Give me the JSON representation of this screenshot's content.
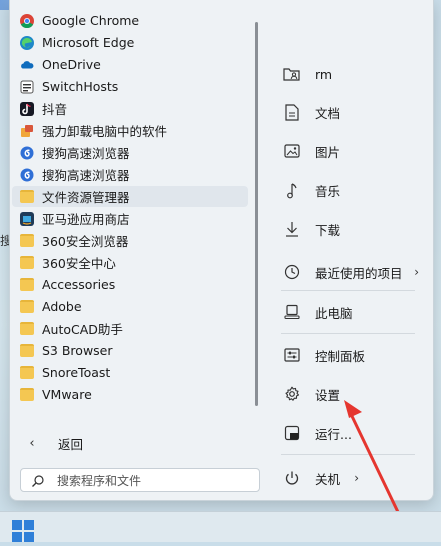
{
  "start_menu": {
    "apps": [
      {
        "label": "Google Chrome",
        "icon": "chrome-icon"
      },
      {
        "label": "Microsoft Edge",
        "icon": "edge-icon"
      },
      {
        "label": "OneDrive",
        "icon": "onedrive-icon"
      },
      {
        "label": "SwitchHosts",
        "icon": "switchhosts-icon"
      },
      {
        "label": "抖音",
        "icon": "douyin-icon"
      },
      {
        "label": "强力卸载电脑中的软件",
        "icon": "uninstall-icon"
      },
      {
        "label": "搜狗高速浏览器",
        "icon": "sogou-browser-icon"
      },
      {
        "label": "搜狗高速浏览器",
        "icon": "sogou-browser-icon"
      },
      {
        "label": "文件资源管理器",
        "icon": "folder-icon"
      },
      {
        "label": "亚马逊应用商店",
        "icon": "amazon-appstore-icon"
      },
      {
        "label": "360安全浏览器",
        "icon": "folder-icon"
      },
      {
        "label": "360安全中心",
        "icon": "folder-icon"
      },
      {
        "label": "Accessories",
        "icon": "folder-icon"
      },
      {
        "label": "Adobe",
        "icon": "folder-icon"
      },
      {
        "label": "AutoCAD助手",
        "icon": "folder-icon"
      },
      {
        "label": "S3 Browser",
        "icon": "folder-icon"
      },
      {
        "label": "SnoreToast",
        "icon": "folder-icon"
      },
      {
        "label": "VMware",
        "icon": "folder-icon"
      }
    ],
    "back_label": "返回",
    "search": {
      "placeholder": "搜索程序和文件"
    },
    "right_pane": {
      "user": "rm",
      "documents": "文档",
      "pictures": "图片",
      "music": "音乐",
      "downloads": "下载",
      "recent": "最近使用的项目",
      "this_pc": "此电脑",
      "control_panel": "控制面板",
      "settings": "设置",
      "run": "运行...",
      "shutdown": "关机"
    }
  },
  "desktop": {
    "sliver_text": "搜"
  },
  "colors": {
    "folder": "#f4c752",
    "annotation_arrow": "#e5362f",
    "selected_row": "#e0e6ec"
  }
}
